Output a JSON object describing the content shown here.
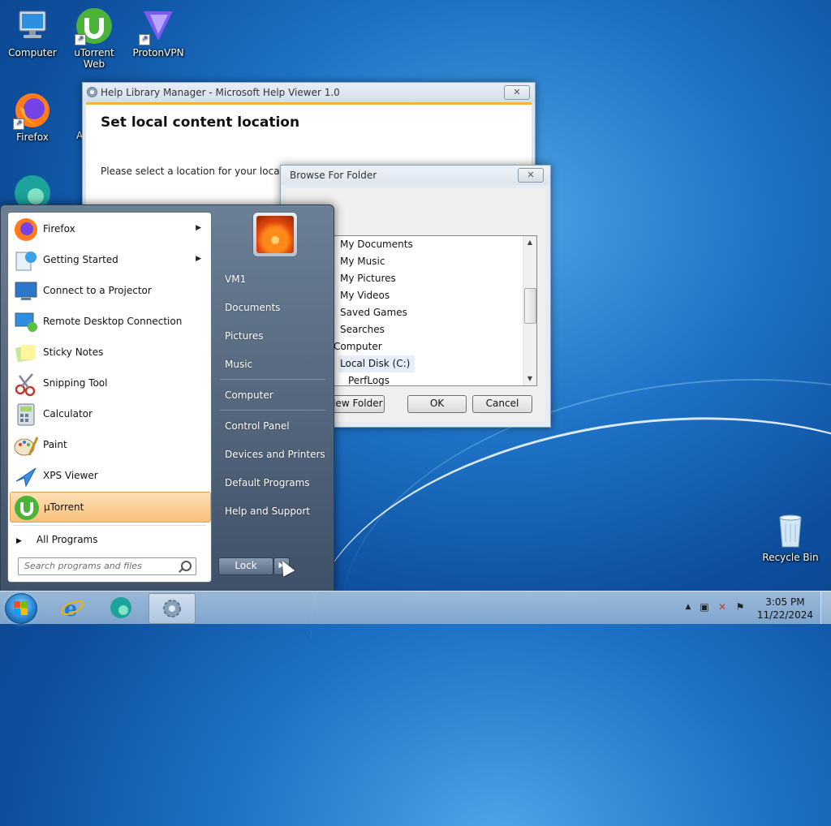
{
  "desktop": {
    "icons": [
      {
        "label": "Computer"
      },
      {
        "label": "uTorrent Web"
      },
      {
        "label": "ProtonVPN"
      },
      {
        "label": "Firefox"
      },
      {
        "label": "A"
      },
      {
        "label": "Recycle Bin"
      }
    ]
  },
  "help_window": {
    "title": "Help Library Manager - Microsoft Help Viewer 1.0",
    "heading": "Set local content location",
    "instruction": "Please select a location for your local cont"
  },
  "browse_dialog": {
    "title": "Browse For Folder",
    "tree": [
      "My Documents",
      "My Music",
      "My Pictures",
      "My Videos",
      "Saved Games",
      "Searches",
      "Computer",
      "Local Disk (C:)",
      "PerfLogs"
    ],
    "selected": "Local Disk (C:)",
    "buttons": {
      "new_folder": "New Folder",
      "ok": "OK",
      "cancel": "Cancel"
    }
  },
  "start_menu": {
    "programs": [
      {
        "label": "Firefox",
        "has_submenu": true
      },
      {
        "label": "Getting Started",
        "has_submenu": true
      },
      {
        "label": "Connect to a Projector",
        "has_submenu": false
      },
      {
        "label": "Remote Desktop Connection",
        "has_submenu": false
      },
      {
        "label": "Sticky Notes",
        "has_submenu": false
      },
      {
        "label": "Snipping Tool",
        "has_submenu": false
      },
      {
        "label": "Calculator",
        "has_submenu": false
      },
      {
        "label": "Paint",
        "has_submenu": false
      },
      {
        "label": "XPS Viewer",
        "has_submenu": false
      },
      {
        "label": "μTorrent",
        "has_submenu": false,
        "highlighted": true
      }
    ],
    "all_programs": "All Programs",
    "search_placeholder": "Search programs and files",
    "right_links": [
      "VM1",
      "Documents",
      "Pictures",
      "Music",
      "Computer",
      "Control Panel",
      "Devices and Printers",
      "Default Programs",
      "Help and Support"
    ],
    "lock_label": "Lock"
  },
  "taskbar": {
    "time": "3:05 PM",
    "date": "11/22/2024"
  },
  "colors": {
    "accent_highlight": "#f8c07a",
    "desktop_blue": "#1e73c7",
    "start_menu_dark": "#3f5168"
  }
}
